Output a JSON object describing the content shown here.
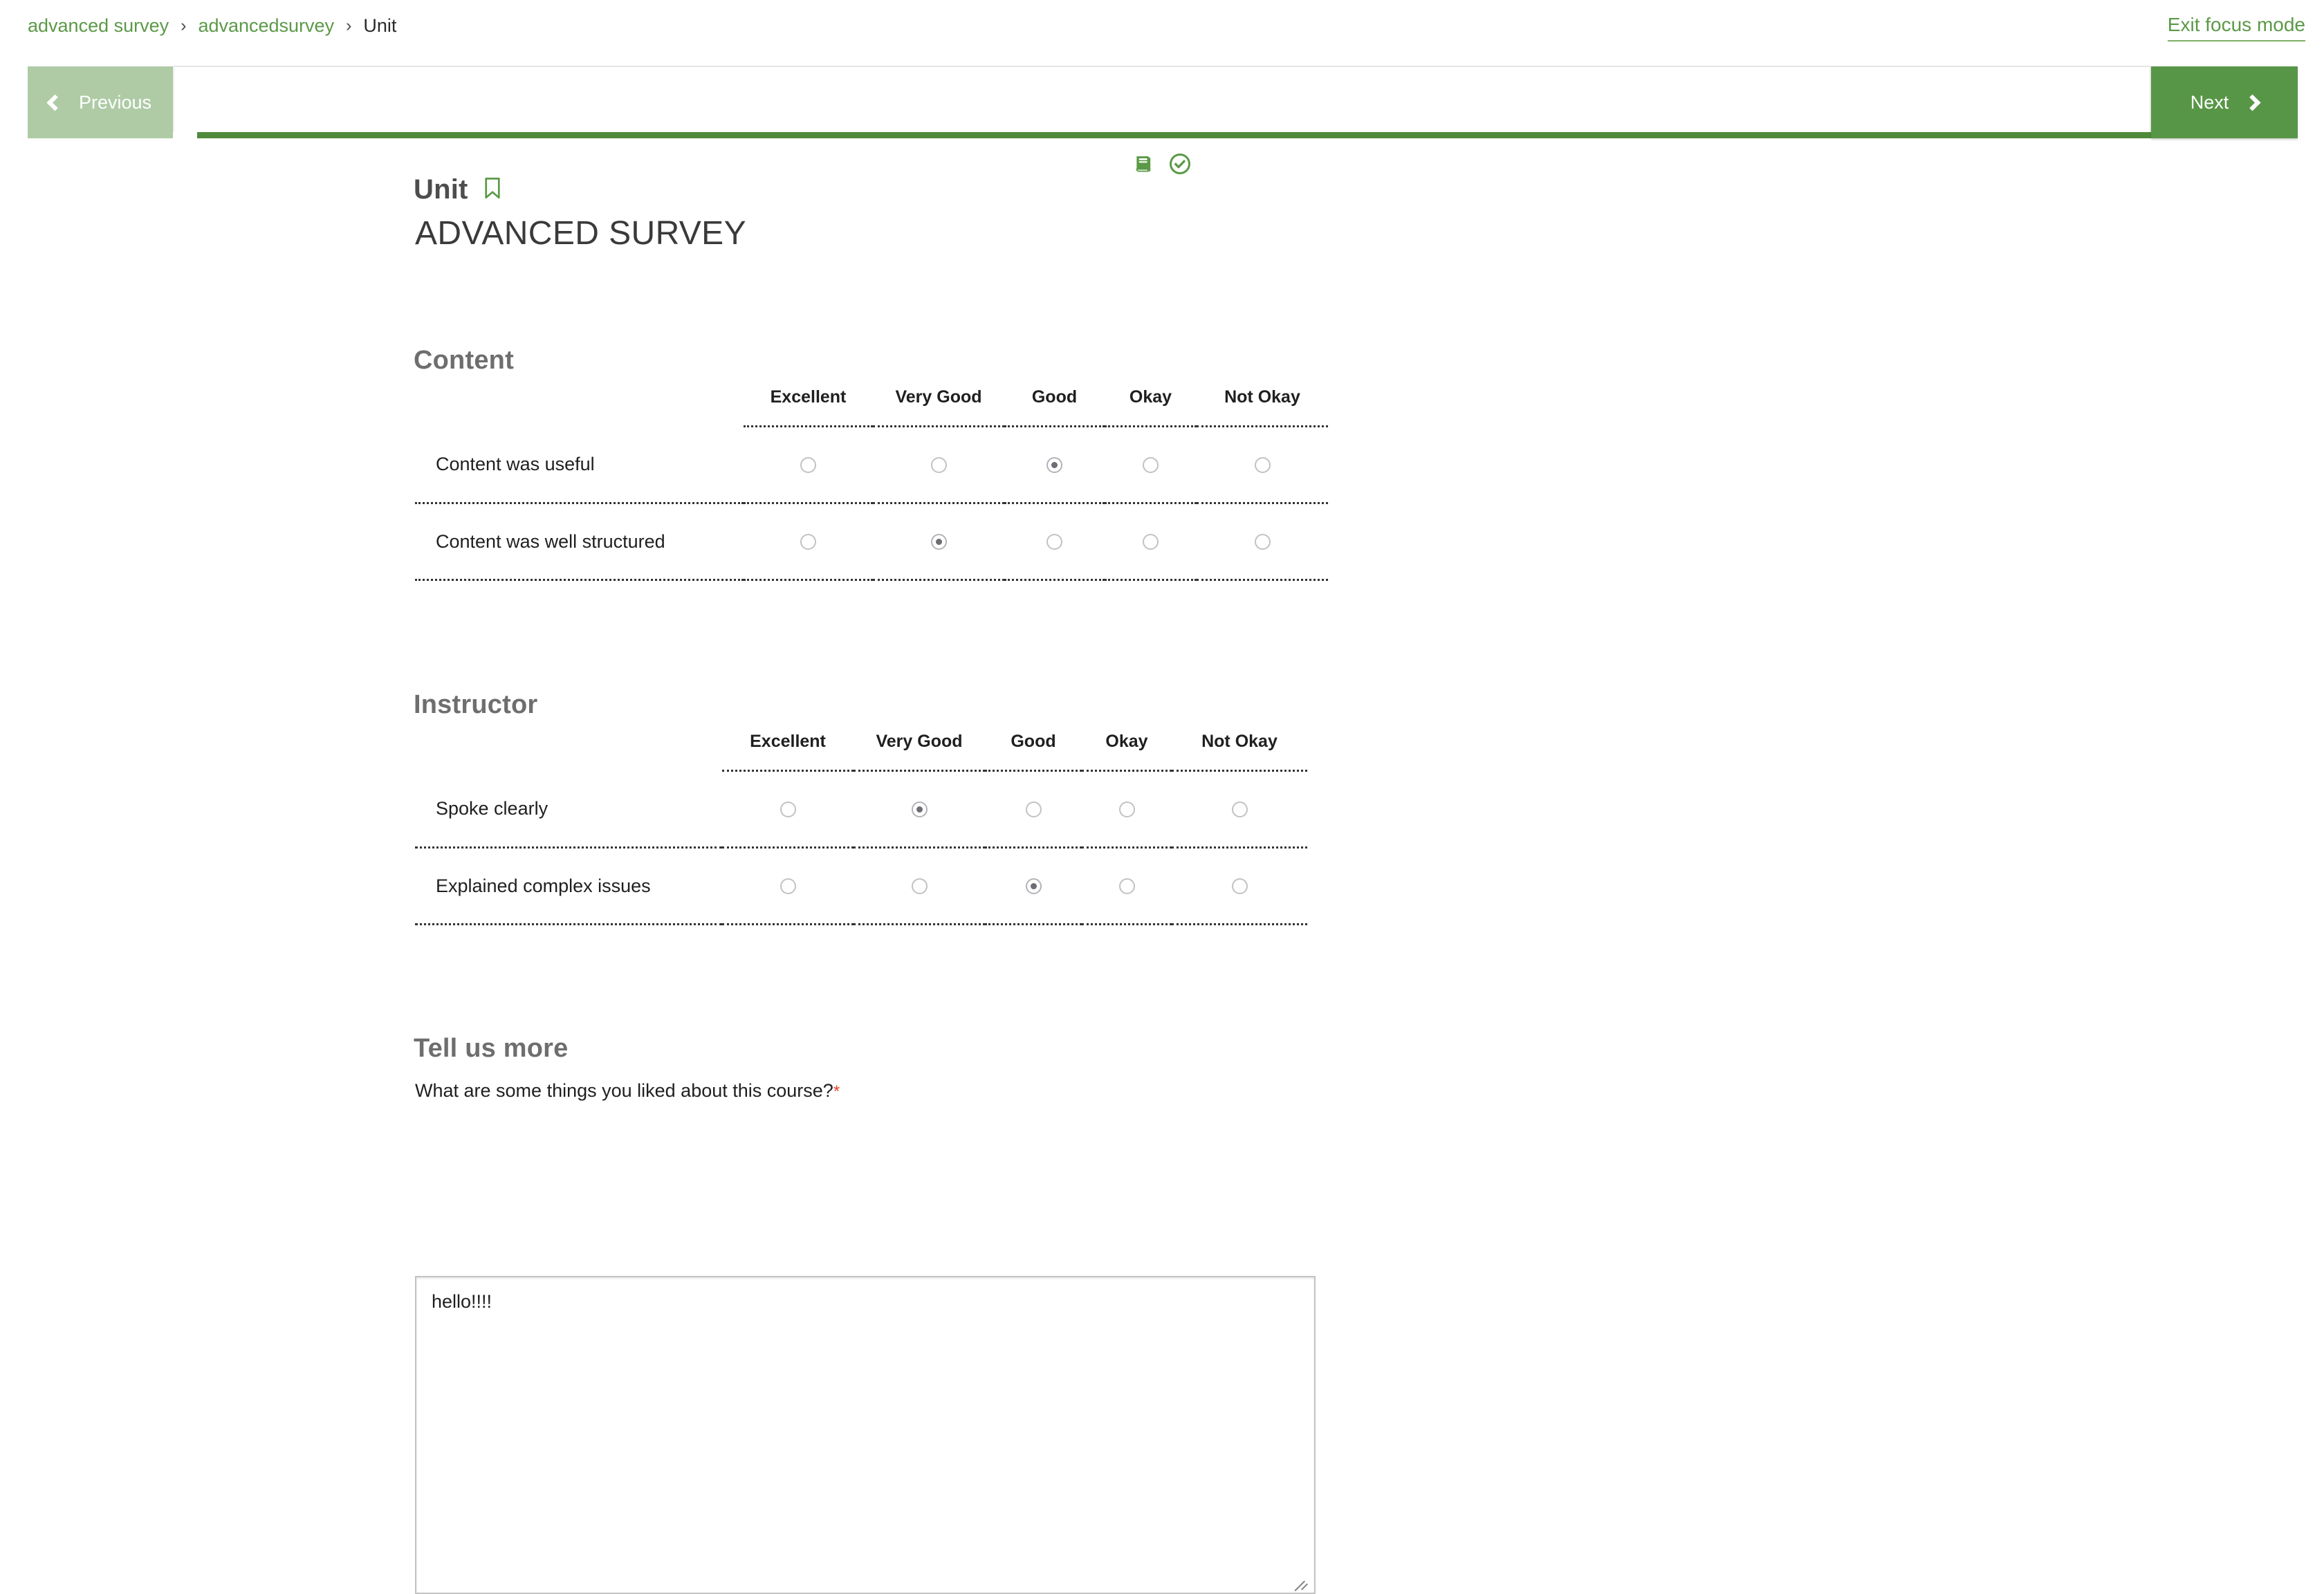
{
  "breadcrumb": {
    "items": [
      {
        "label": "advanced survey",
        "type": "link"
      },
      {
        "label": "advancedsurvey",
        "type": "link"
      },
      {
        "label": "Unit",
        "type": "current"
      }
    ],
    "separator": "›"
  },
  "header": {
    "exit_focus_label": "Exit focus mode"
  },
  "navbar": {
    "previous_label": "Previous",
    "next_label": "Next",
    "icons": [
      "book-icon",
      "check-circle-icon"
    ],
    "progress_percent": 100
  },
  "unit": {
    "label": "Unit",
    "bookmark_icon": "bookmark-icon",
    "title": "ADVANCED SURVEY"
  },
  "sections": [
    {
      "id": "content",
      "heading": "Content",
      "columns": [
        "Excellent",
        "Very Good",
        "Good",
        "Okay",
        "Not Okay"
      ],
      "rows": [
        {
          "question": "Content was useful",
          "selected": 2
        },
        {
          "question": "Content was well structured",
          "selected": 1
        }
      ]
    },
    {
      "id": "instructor",
      "heading": "Instructor",
      "columns": [
        "Excellent",
        "Very Good",
        "Good",
        "Okay",
        "Not Okay"
      ],
      "rows": [
        {
          "question": "Spoke clearly",
          "selected": 1
        },
        {
          "question": "Explained complex issues",
          "selected": 2
        }
      ]
    }
  ],
  "tell_us_more": {
    "heading": "Tell us more",
    "question": "What are some things you liked about this course?",
    "required_marker": "*",
    "answer_value": "hello!!!!",
    "answer_placeholder": ""
  },
  "colors": {
    "brand_green": "#589647",
    "brand_green_muted": "#aecba5",
    "link_green": "#5b9947",
    "progress_green": "#4f8a3c",
    "required_red": "#e8402a",
    "heading_gray": "#6e6e6e"
  }
}
